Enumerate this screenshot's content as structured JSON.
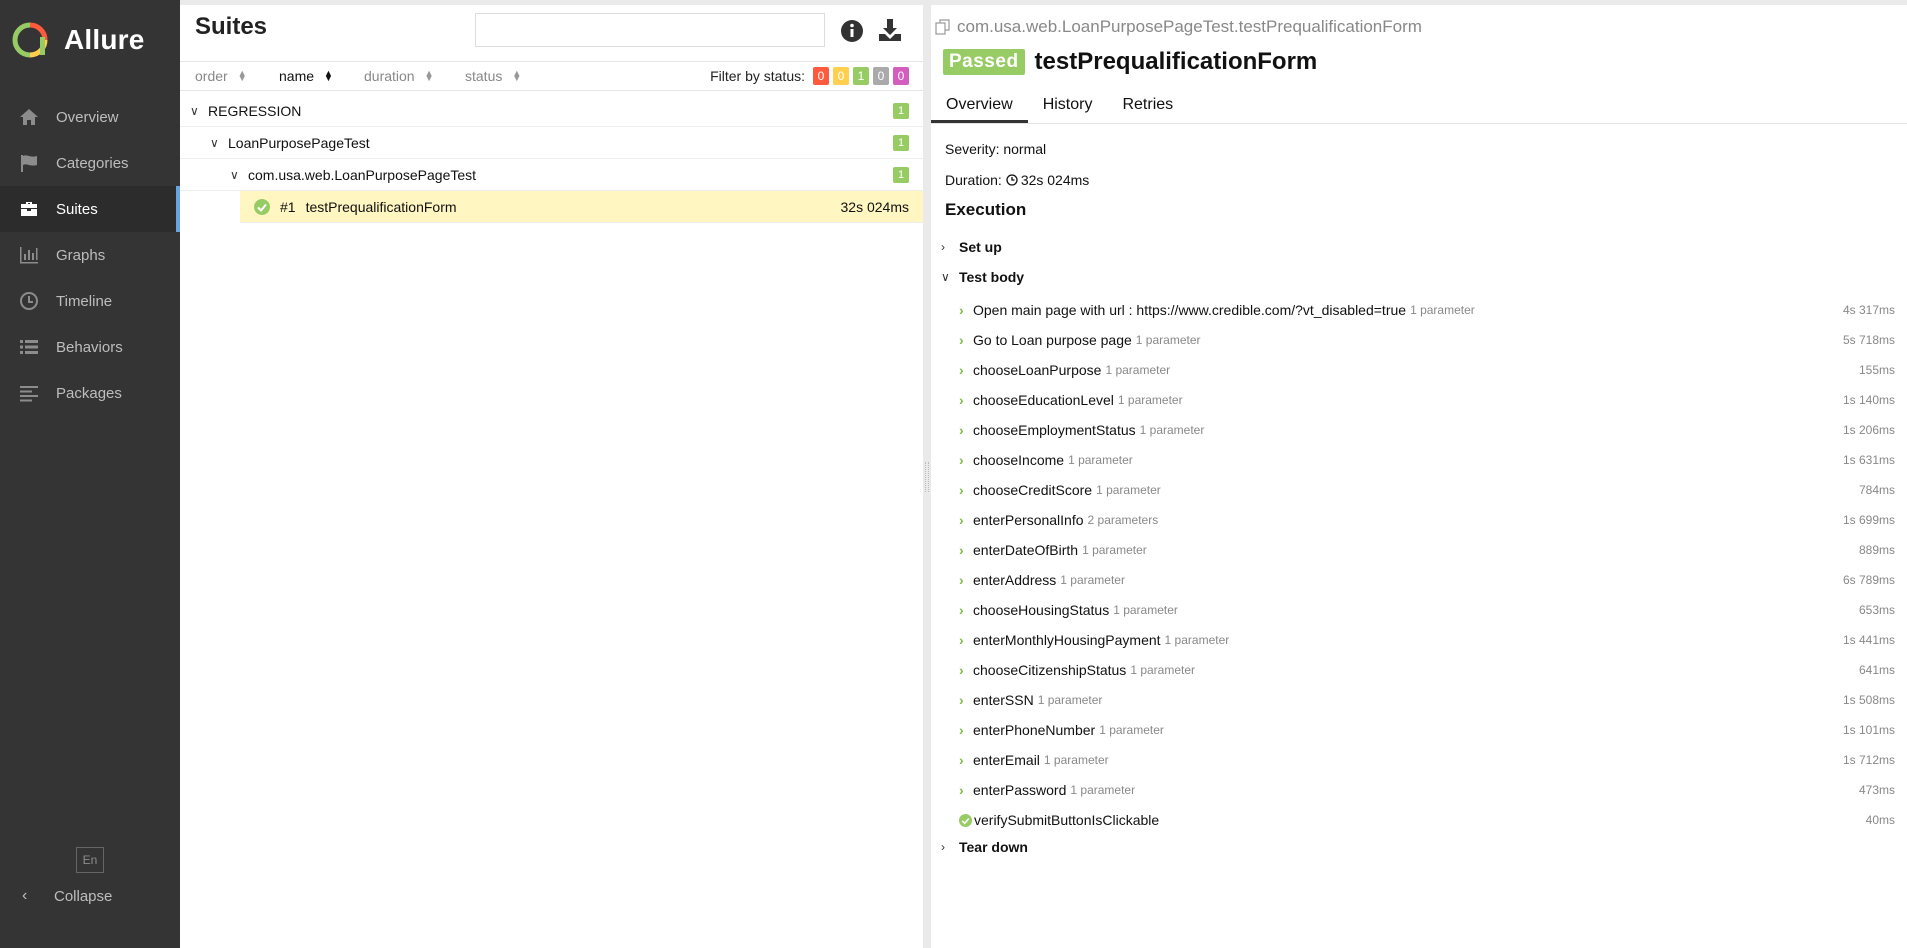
{
  "app": {
    "name": "Allure"
  },
  "sidebar": {
    "items": [
      {
        "label": "Overview",
        "icon": "home-icon"
      },
      {
        "label": "Categories",
        "icon": "flag-icon"
      },
      {
        "label": "Suites",
        "icon": "briefcase-icon",
        "active": true
      },
      {
        "label": "Graphs",
        "icon": "bar-chart-icon"
      },
      {
        "label": "Timeline",
        "icon": "clock-icon"
      },
      {
        "label": "Behaviors",
        "icon": "list-icon"
      },
      {
        "label": "Packages",
        "icon": "align-left-icon"
      }
    ],
    "language": "En",
    "collapse_label": "Collapse"
  },
  "suites": {
    "title": "Suites",
    "search_placeholder": "",
    "sort": {
      "order": "order",
      "name": "name",
      "duration": "duration",
      "status": "status"
    },
    "filter_label": "Filter by status:",
    "status_counts": [
      {
        "value": "0",
        "color": "#fd5a3e"
      },
      {
        "value": "0",
        "color": "#ffd050"
      },
      {
        "value": "1",
        "color": "#97cc64"
      },
      {
        "value": "0",
        "color": "#aaaaaa"
      },
      {
        "value": "0",
        "color": "#d35ebe"
      }
    ],
    "tree": {
      "root": {
        "label": "REGRESSION",
        "count": "1"
      },
      "child": {
        "label": "LoanPurposePageTest",
        "count": "1"
      },
      "grandchild": {
        "label": "com.usa.web.LoanPurposePageTest",
        "count": "1"
      },
      "leaf": {
        "number": "#1",
        "label": "testPrequalificationForm",
        "duration": "32s 024ms"
      }
    }
  },
  "test": {
    "full_name": "com.usa.web.LoanPurposePageTest.testPrequalificationForm",
    "status": "Passed",
    "name": "testPrequalificationForm",
    "tabs": [
      "Overview",
      "History",
      "Retries"
    ],
    "severity": "Severity: normal",
    "duration_label": "Duration:",
    "duration_value": "32s 024ms",
    "execution_title": "Execution",
    "setup_label": "Set up",
    "body_label": "Test body",
    "teardown_label": "Tear down",
    "steps": [
      {
        "name": "Open main page with url : https://www.credible.com/?vt_disabled=true",
        "param": "1 parameter",
        "duration": "4s 317ms"
      },
      {
        "name": "Go to Loan purpose page",
        "param": "1 parameter",
        "duration": "5s 718ms"
      },
      {
        "name": "chooseLoanPurpose",
        "param": "1 parameter",
        "duration": "155ms"
      },
      {
        "name": "chooseEducationLevel",
        "param": "1 parameter",
        "duration": "1s 140ms"
      },
      {
        "name": "chooseEmploymentStatus",
        "param": "1 parameter",
        "duration": "1s 206ms"
      },
      {
        "name": "chooseIncome",
        "param": "1 parameter",
        "duration": "1s 631ms"
      },
      {
        "name": "chooseCreditScore",
        "param": "1 parameter",
        "duration": "784ms"
      },
      {
        "name": "enterPersonalInfo",
        "param": "2 parameters",
        "duration": "1s 699ms"
      },
      {
        "name": "enterDateOfBirth",
        "param": "1 parameter",
        "duration": "889ms"
      },
      {
        "name": "enterAddress",
        "param": "1 parameter",
        "duration": "6s 789ms"
      },
      {
        "name": "chooseHousingStatus",
        "param": "1 parameter",
        "duration": "653ms"
      },
      {
        "name": "enterMonthlyHousingPayment",
        "param": "1 parameter",
        "duration": "1s 441ms"
      },
      {
        "name": "chooseCitizenshipStatus",
        "param": "1 parameter",
        "duration": "641ms"
      },
      {
        "name": "enterSSN",
        "param": "1 parameter",
        "duration": "1s 508ms"
      },
      {
        "name": "enterPhoneNumber",
        "param": "1 parameter",
        "duration": "1s 101ms"
      },
      {
        "name": "enterEmail",
        "param": "1 parameter",
        "duration": "1s 712ms"
      },
      {
        "name": "enterPassword",
        "param": "1 parameter",
        "duration": "473ms"
      },
      {
        "name": "verifySubmitButtonIsClickable",
        "param": "",
        "duration": "40ms",
        "leaf": true
      }
    ]
  },
  "colors": {
    "passed": "#97cc64",
    "sidebar": "#343434",
    "active_accent": "#66a3e0",
    "selected_row": "#fff6c1"
  }
}
